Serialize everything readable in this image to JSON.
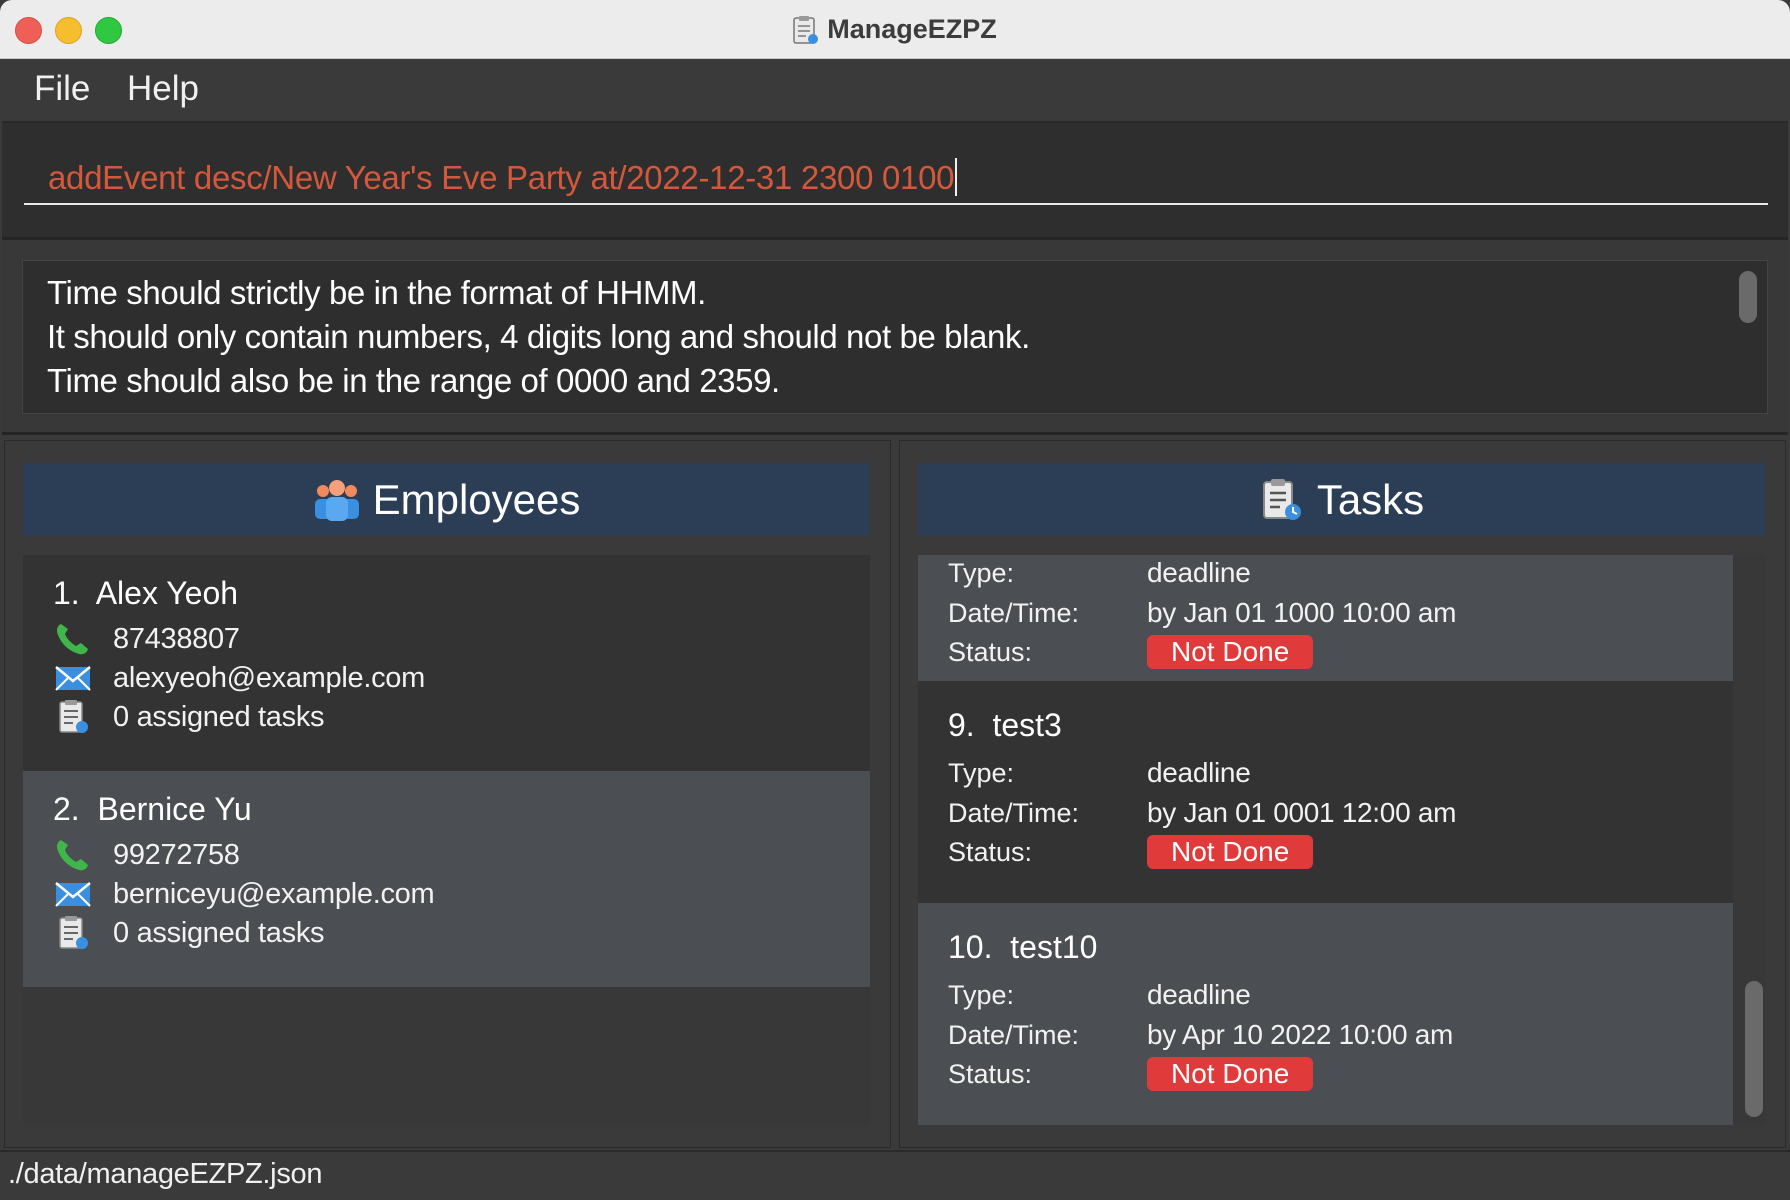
{
  "window": {
    "title": "ManageEZPZ"
  },
  "menu": {
    "file": "File",
    "help": "Help"
  },
  "command": {
    "value": "addEvent desc/New Year's Eve Party at/2022-12-31 2300 0100"
  },
  "result": {
    "lines": [
      "Time should strictly be in the format of HHMM.",
      "It should only contain numbers, 4 digits long and should not be blank.",
      "Time should also be in the range of 0000 and 2359."
    ]
  },
  "employees": {
    "header": "Employees",
    "items": [
      {
        "index": "1.",
        "name": "Alex Yeoh",
        "phone": "87438807",
        "email": "alexyeoh@example.com",
        "tasks": "0 assigned tasks"
      },
      {
        "index": "2.",
        "name": "Bernice Yu",
        "phone": "99272758",
        "email": "berniceyu@example.com",
        "tasks": "0 assigned tasks"
      }
    ]
  },
  "tasks": {
    "header": "Tasks",
    "labels": {
      "type": "Type:",
      "datetime": "Date/Time:",
      "status": "Status:"
    },
    "partial": {
      "type": "deadline",
      "datetime": "by Jan 01 1000 10:00 am",
      "status": "Not Done"
    },
    "items": [
      {
        "index": "9.",
        "name": "test3",
        "type": "deadline",
        "datetime": "by Jan 01 0001 12:00 am",
        "status": "Not Done"
      },
      {
        "index": "10.",
        "name": "test10",
        "type": "deadline",
        "datetime": "by Apr 10 2022 10:00 am",
        "status": "Not Done"
      }
    ]
  },
  "status_bar": {
    "path": "./data/manageEZPZ.json"
  },
  "colors": {
    "header_bg": "#2c3e55",
    "badge_red": "#e03a3a",
    "command_text": "#d4593c",
    "phone_green": "#3fb54a",
    "mail_blue": "#3a8fe0"
  },
  "icons": {
    "title": "task-list-icon",
    "employees": "people-icon",
    "tasks": "task-list-icon",
    "phone": "phone-icon",
    "email": "envelope-icon",
    "assigned": "task-list-icon"
  }
}
